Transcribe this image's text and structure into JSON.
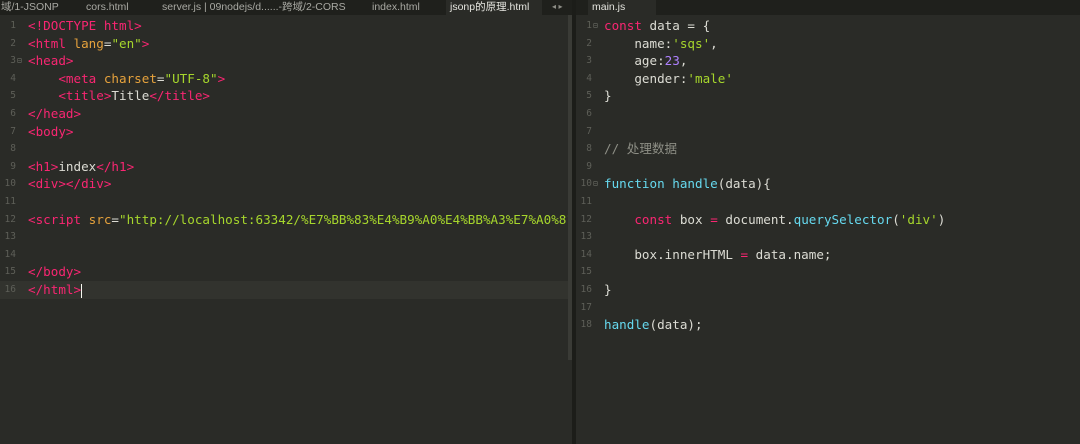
{
  "tabs_left": [
    {
      "label": "域/1-JSONP",
      "active": false
    },
    {
      "label": "cors.html",
      "active": false
    },
    {
      "label": "server.js | 09nodejs/d......-跨域/2-CORS",
      "active": false
    },
    {
      "label": "index.html",
      "active": false
    },
    {
      "label": "jsonp的原理.html",
      "active": true
    }
  ],
  "tab_scroll_arrows": "◂ ▸",
  "tabs_right": [
    {
      "label": "main.js",
      "active": true
    }
  ],
  "editor_left": {
    "lines": [
      {
        "n": "1",
        "fold": "",
        "tokens": [
          [
            "t-tag",
            "<!DOCTYPE html>"
          ]
        ]
      },
      {
        "n": "2",
        "fold": "",
        "tokens": [
          [
            "t-tag",
            "<html "
          ],
          [
            "t-attr",
            "lang"
          ],
          [
            "t-pun",
            "="
          ],
          [
            "t-str",
            "\"en\""
          ],
          [
            "t-tag",
            ">"
          ]
        ]
      },
      {
        "n": "3",
        "fold": "⊟",
        "tokens": [
          [
            "t-tag",
            "<head>"
          ]
        ]
      },
      {
        "n": "4",
        "fold": "",
        "tokens": [
          [
            "t-txt",
            "    "
          ],
          [
            "t-tag",
            "<meta "
          ],
          [
            "t-attr",
            "charset"
          ],
          [
            "t-pun",
            "="
          ],
          [
            "t-str",
            "\"UTF-8\""
          ],
          [
            "t-tag",
            ">"
          ]
        ]
      },
      {
        "n": "5",
        "fold": "",
        "tokens": [
          [
            "t-txt",
            "    "
          ],
          [
            "t-tag",
            "<title>"
          ],
          [
            "t-txt",
            "Title"
          ],
          [
            "t-tag",
            "</title>"
          ]
        ]
      },
      {
        "n": "6",
        "fold": "",
        "tokens": [
          [
            "t-tag",
            "</head>"
          ]
        ]
      },
      {
        "n": "7",
        "fold": "",
        "tokens": [
          [
            "t-tag",
            "<body>"
          ]
        ]
      },
      {
        "n": "8",
        "fold": "",
        "tokens": []
      },
      {
        "n": "9",
        "fold": "",
        "tokens": [
          [
            "t-tag",
            "<h1>"
          ],
          [
            "t-txt",
            "index"
          ],
          [
            "t-tag",
            "</h1>"
          ]
        ]
      },
      {
        "n": "10",
        "fold": "",
        "tokens": [
          [
            "t-tag",
            "<div></div>"
          ]
        ]
      },
      {
        "n": "11",
        "fold": "",
        "tokens": []
      },
      {
        "n": "12",
        "fold": "",
        "tokens": [
          [
            "t-tag",
            "<script "
          ],
          [
            "t-attr",
            "src"
          ],
          [
            "t-pun",
            "="
          ],
          [
            "t-str",
            "\"http://localhost:63342/%E7%BB%83%E4%B9%A0%E4%BB%A3%E7%A0%81"
          ]
        ]
      },
      {
        "n": "13",
        "fold": "",
        "tokens": []
      },
      {
        "n": "14",
        "fold": "",
        "tokens": []
      },
      {
        "n": "15",
        "fold": "",
        "tokens": [
          [
            "t-tag",
            "</body>"
          ]
        ]
      },
      {
        "n": "16",
        "fold": "",
        "tokens": [
          [
            "t-tag",
            "</html>"
          ]
        ],
        "current": true,
        "cursor": true
      }
    ]
  },
  "editor_right": {
    "lines": [
      {
        "n": "1",
        "fold": "⊟",
        "tokens": [
          [
            "t-kw",
            "const "
          ],
          [
            "t-pun",
            "data = {"
          ]
        ]
      },
      {
        "n": "2",
        "fold": "",
        "tokens": [
          [
            "t-txt",
            "    name:"
          ],
          [
            "t-str",
            "'sqs'"
          ],
          [
            "t-pun",
            ","
          ]
        ]
      },
      {
        "n": "3",
        "fold": "",
        "tokens": [
          [
            "t-txt",
            "    age:"
          ],
          [
            "t-num",
            "23"
          ],
          [
            "t-pun",
            ","
          ]
        ]
      },
      {
        "n": "4",
        "fold": "",
        "tokens": [
          [
            "t-txt",
            "    gender:"
          ],
          [
            "t-str",
            "'male'"
          ]
        ]
      },
      {
        "n": "5",
        "fold": "",
        "tokens": [
          [
            "t-pun",
            "}"
          ]
        ]
      },
      {
        "n": "6",
        "fold": "",
        "tokens": []
      },
      {
        "n": "7",
        "fold": "",
        "tokens": []
      },
      {
        "n": "8",
        "fold": "",
        "tokens": [
          [
            "t-cmt",
            "// 处理数据"
          ]
        ]
      },
      {
        "n": "9",
        "fold": "",
        "tokens": []
      },
      {
        "n": "10",
        "fold": "⊟",
        "tokens": [
          [
            "t-fn",
            "function "
          ],
          [
            "t-fn",
            "handle"
          ],
          [
            "t-pun",
            "(data){"
          ]
        ]
      },
      {
        "n": "11",
        "fold": "",
        "tokens": []
      },
      {
        "n": "12",
        "fold": "",
        "tokens": [
          [
            "t-txt",
            "    "
          ],
          [
            "t-kw",
            "const "
          ],
          [
            "t-txt",
            "box "
          ],
          [
            "t-kw",
            "= "
          ],
          [
            "t-txt",
            "document."
          ],
          [
            "t-fn",
            "querySelector"
          ],
          [
            "t-pun",
            "("
          ],
          [
            "t-str",
            "'div'"
          ],
          [
            "t-pun",
            ")"
          ]
        ]
      },
      {
        "n": "13",
        "fold": "",
        "tokens": []
      },
      {
        "n": "14",
        "fold": "",
        "tokens": [
          [
            "t-txt",
            "    box.innerHTML "
          ],
          [
            "t-kw",
            "= "
          ],
          [
            "t-txt",
            "data.name;"
          ]
        ]
      },
      {
        "n": "15",
        "fold": "",
        "tokens": []
      },
      {
        "n": "16",
        "fold": "",
        "tokens": [
          [
            "t-pun",
            "}"
          ]
        ]
      },
      {
        "n": "17",
        "fold": "",
        "tokens": []
      },
      {
        "n": "18",
        "fold": "",
        "tokens": [
          [
            "t-fn",
            "handle"
          ],
          [
            "t-pun",
            "(data);"
          ]
        ]
      }
    ]
  }
}
